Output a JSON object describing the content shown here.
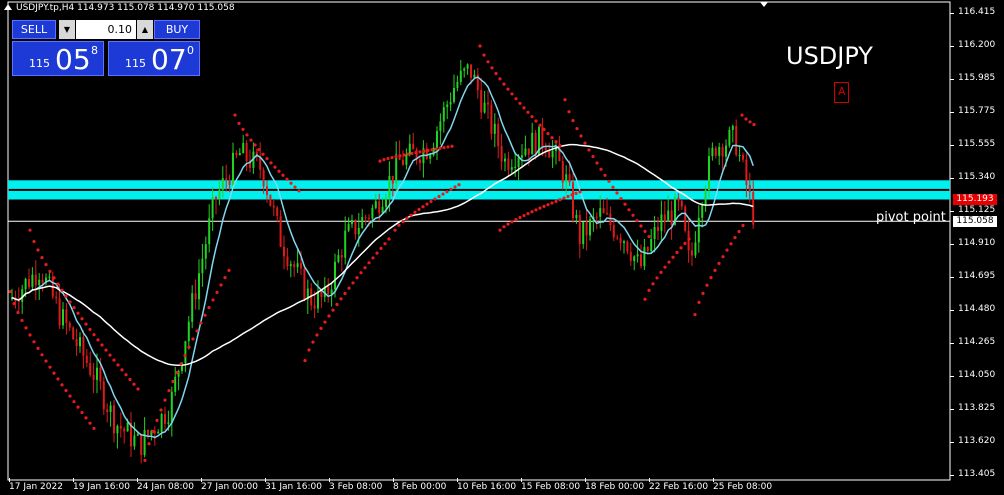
{
  "header": {
    "title_line": "USDJPY.tp,H4  114.973 115.078 114.970 115.058"
  },
  "trade_panel": {
    "sell_label": "SELL",
    "buy_label": "BUY",
    "lot_value": "0.10",
    "sell_prefix": "115",
    "sell_main": "05",
    "sell_sup": "8",
    "buy_prefix": "115",
    "buy_main": "07",
    "buy_sup": "0"
  },
  "symbol_label": "USDJPY",
  "marker_glyph": "A",
  "pivot_label": "pivot point",
  "price_axis": {
    "ticks": [
      "116.415",
      "116.200",
      "115.985",
      "115.775",
      "115.555",
      "115.340",
      "115.125",
      "114.910",
      "114.695",
      "114.480",
      "114.265",
      "114.050",
      "113.825",
      "113.620",
      "113.405"
    ],
    "current_price_red": "115.193",
    "current_price_white": "115.058"
  },
  "time_axis": {
    "ticks": [
      "17 Jan 2022",
      "19 Jan 16:00",
      "24 Jan 08:00",
      "27 Jan 00:00",
      "31 Jan 16:00",
      "3 Feb 08:00",
      "8 Feb 00:00",
      "10 Feb 16:00",
      "15 Feb 08:00",
      "18 Feb 00:00",
      "22 Feb 16:00",
      "25 Feb 08:00"
    ]
  },
  "colors": {
    "bull_candle": "#22d422",
    "bear_candle": "#e01a1a",
    "sar_dots": "#e81c1c",
    "ma_fast": "#7fd8f0",
    "ma_slow": "#ffffff",
    "zone_fill": "#00f0f0",
    "pivot_line": "#ffffff",
    "background": "#000000"
  },
  "chart_data": {
    "type": "candlestick",
    "symbol": "USDJPY.tp",
    "timeframe": "H4",
    "ylim": [
      113.405,
      116.415
    ],
    "ohlc_last": {
      "open": 114.973,
      "high": 115.078,
      "low": 114.97,
      "close": 115.058
    },
    "anchors": [
      {
        "x": "17 Jan 2022",
        "price": 114.55
      },
      {
        "x": "19 Jan 16:00",
        "price": 114.3
      },
      {
        "x": "24 Jan 08:00",
        "price": 113.85
      },
      {
        "x": "27 Jan 00:00",
        "price": 115.25
      },
      {
        "x": "31 Jan 16:00",
        "price": 114.85
      },
      {
        "x": "3 Feb 08:00",
        "price": 114.75
      },
      {
        "x": "8 Feb 00:00",
        "price": 115.6
      },
      {
        "x": "10 Feb 16:00",
        "price": 116.0
      },
      {
        "x": "15 Feb 08:00",
        "price": 115.5
      },
      {
        "x": "18 Feb 00:00",
        "price": 114.95
      },
      {
        "x": "22 Feb 16:00",
        "price": 114.95
      },
      {
        "x": "25 Feb 08:00",
        "price": 115.2
      }
    ],
    "resistance_zone": [
      115.2,
      115.325
    ],
    "pivot_level": 115.058
  }
}
